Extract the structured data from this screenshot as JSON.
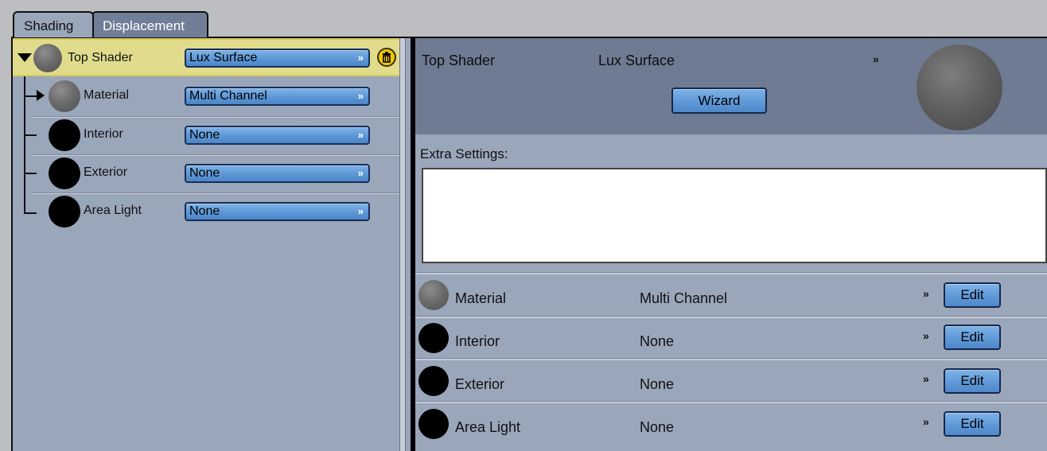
{
  "tabs": [
    {
      "label": "Shading",
      "active": true
    },
    {
      "label": "Displacement",
      "active": false
    }
  ],
  "tree": {
    "root": {
      "label": "Top Shader",
      "value": "Lux Surface",
      "ball": "gray"
    },
    "children": [
      {
        "label": "Material",
        "value": "Multi Channel",
        "ball": "gray"
      },
      {
        "label": "Interior",
        "value": "None",
        "ball": "black"
      },
      {
        "label": "Exterior",
        "value": "None",
        "ball": "black"
      },
      {
        "label": "Area Light",
        "value": "None",
        "ball": "black"
      }
    ],
    "delete_icon": "trash-icon"
  },
  "details": {
    "title": "Top Shader",
    "shader_type": "Lux Surface",
    "wizard_label": "Wizard",
    "extra_settings_label": "Extra Settings:",
    "extra_settings_value": "",
    "properties": [
      {
        "label": "Material",
        "value": "Multi Channel",
        "edit_label": "Edit",
        "ball": "gray"
      },
      {
        "label": "Interior",
        "value": "None",
        "edit_label": "Edit",
        "ball": "black"
      },
      {
        "label": "Exterior",
        "value": "None",
        "edit_label": "Edit",
        "ball": "black"
      },
      {
        "label": "Area Light",
        "value": "None",
        "edit_label": "Edit",
        "ball": "black"
      }
    ]
  },
  "colors": {
    "panel_bg": "#9aa6ba",
    "header_bg": "#6e7b93",
    "selection_bg": "#e0dc8c",
    "button_blue": "#5d97d6"
  }
}
